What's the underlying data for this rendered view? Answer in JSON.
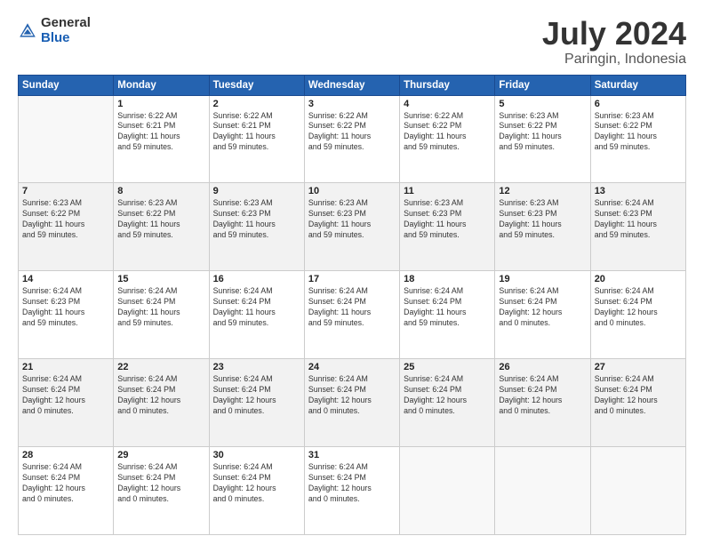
{
  "logo": {
    "general": "General",
    "blue": "Blue"
  },
  "title": "July 2024",
  "location": "Paringin, Indonesia",
  "days_of_week": [
    "Sunday",
    "Monday",
    "Tuesday",
    "Wednesday",
    "Thursday",
    "Friday",
    "Saturday"
  ],
  "weeks": [
    [
      {
        "day": "",
        "content": ""
      },
      {
        "day": "1",
        "content": "Sunrise: 6:22 AM\nSunset: 6:21 PM\nDaylight: 11 hours\nand 59 minutes."
      },
      {
        "day": "2",
        "content": "Sunrise: 6:22 AM\nSunset: 6:21 PM\nDaylight: 11 hours\nand 59 minutes."
      },
      {
        "day": "3",
        "content": "Sunrise: 6:22 AM\nSunset: 6:22 PM\nDaylight: 11 hours\nand 59 minutes."
      },
      {
        "day": "4",
        "content": "Sunrise: 6:22 AM\nSunset: 6:22 PM\nDaylight: 11 hours\nand 59 minutes."
      },
      {
        "day": "5",
        "content": "Sunrise: 6:23 AM\nSunset: 6:22 PM\nDaylight: 11 hours\nand 59 minutes."
      },
      {
        "day": "6",
        "content": "Sunrise: 6:23 AM\nSunset: 6:22 PM\nDaylight: 11 hours\nand 59 minutes."
      }
    ],
    [
      {
        "day": "7",
        "content": "Sunrise: 6:23 AM\nSunset: 6:22 PM\nDaylight: 11 hours\nand 59 minutes."
      },
      {
        "day": "8",
        "content": "Sunrise: 6:23 AM\nSunset: 6:22 PM\nDaylight: 11 hours\nand 59 minutes."
      },
      {
        "day": "9",
        "content": "Sunrise: 6:23 AM\nSunset: 6:23 PM\nDaylight: 11 hours\nand 59 minutes."
      },
      {
        "day": "10",
        "content": "Sunrise: 6:23 AM\nSunset: 6:23 PM\nDaylight: 11 hours\nand 59 minutes."
      },
      {
        "day": "11",
        "content": "Sunrise: 6:23 AM\nSunset: 6:23 PM\nDaylight: 11 hours\nand 59 minutes."
      },
      {
        "day": "12",
        "content": "Sunrise: 6:23 AM\nSunset: 6:23 PM\nDaylight: 11 hours\nand 59 minutes."
      },
      {
        "day": "13",
        "content": "Sunrise: 6:24 AM\nSunset: 6:23 PM\nDaylight: 11 hours\nand 59 minutes."
      }
    ],
    [
      {
        "day": "14",
        "content": "Sunrise: 6:24 AM\nSunset: 6:23 PM\nDaylight: 11 hours\nand 59 minutes."
      },
      {
        "day": "15",
        "content": "Sunrise: 6:24 AM\nSunset: 6:24 PM\nDaylight: 11 hours\nand 59 minutes."
      },
      {
        "day": "16",
        "content": "Sunrise: 6:24 AM\nSunset: 6:24 PM\nDaylight: 11 hours\nand 59 minutes."
      },
      {
        "day": "17",
        "content": "Sunrise: 6:24 AM\nSunset: 6:24 PM\nDaylight: 11 hours\nand 59 minutes."
      },
      {
        "day": "18",
        "content": "Sunrise: 6:24 AM\nSunset: 6:24 PM\nDaylight: 11 hours\nand 59 minutes."
      },
      {
        "day": "19",
        "content": "Sunrise: 6:24 AM\nSunset: 6:24 PM\nDaylight: 12 hours\nand 0 minutes."
      },
      {
        "day": "20",
        "content": "Sunrise: 6:24 AM\nSunset: 6:24 PM\nDaylight: 12 hours\nand 0 minutes."
      }
    ],
    [
      {
        "day": "21",
        "content": "Sunrise: 6:24 AM\nSunset: 6:24 PM\nDaylight: 12 hours\nand 0 minutes."
      },
      {
        "day": "22",
        "content": "Sunrise: 6:24 AM\nSunset: 6:24 PM\nDaylight: 12 hours\nand 0 minutes."
      },
      {
        "day": "23",
        "content": "Sunrise: 6:24 AM\nSunset: 6:24 PM\nDaylight: 12 hours\nand 0 minutes."
      },
      {
        "day": "24",
        "content": "Sunrise: 6:24 AM\nSunset: 6:24 PM\nDaylight: 12 hours\nand 0 minutes."
      },
      {
        "day": "25",
        "content": "Sunrise: 6:24 AM\nSunset: 6:24 PM\nDaylight: 12 hours\nand 0 minutes."
      },
      {
        "day": "26",
        "content": "Sunrise: 6:24 AM\nSunset: 6:24 PM\nDaylight: 12 hours\nand 0 minutes."
      },
      {
        "day": "27",
        "content": "Sunrise: 6:24 AM\nSunset: 6:24 PM\nDaylight: 12 hours\nand 0 minutes."
      }
    ],
    [
      {
        "day": "28",
        "content": "Sunrise: 6:24 AM\nSunset: 6:24 PM\nDaylight: 12 hours\nand 0 minutes."
      },
      {
        "day": "29",
        "content": "Sunrise: 6:24 AM\nSunset: 6:24 PM\nDaylight: 12 hours\nand 0 minutes."
      },
      {
        "day": "30",
        "content": "Sunrise: 6:24 AM\nSunset: 6:24 PM\nDaylight: 12 hours\nand 0 minutes."
      },
      {
        "day": "31",
        "content": "Sunrise: 6:24 AM\nSunset: 6:24 PM\nDaylight: 12 hours\nand 0 minutes."
      },
      {
        "day": "",
        "content": ""
      },
      {
        "day": "",
        "content": ""
      },
      {
        "day": "",
        "content": ""
      }
    ]
  ]
}
